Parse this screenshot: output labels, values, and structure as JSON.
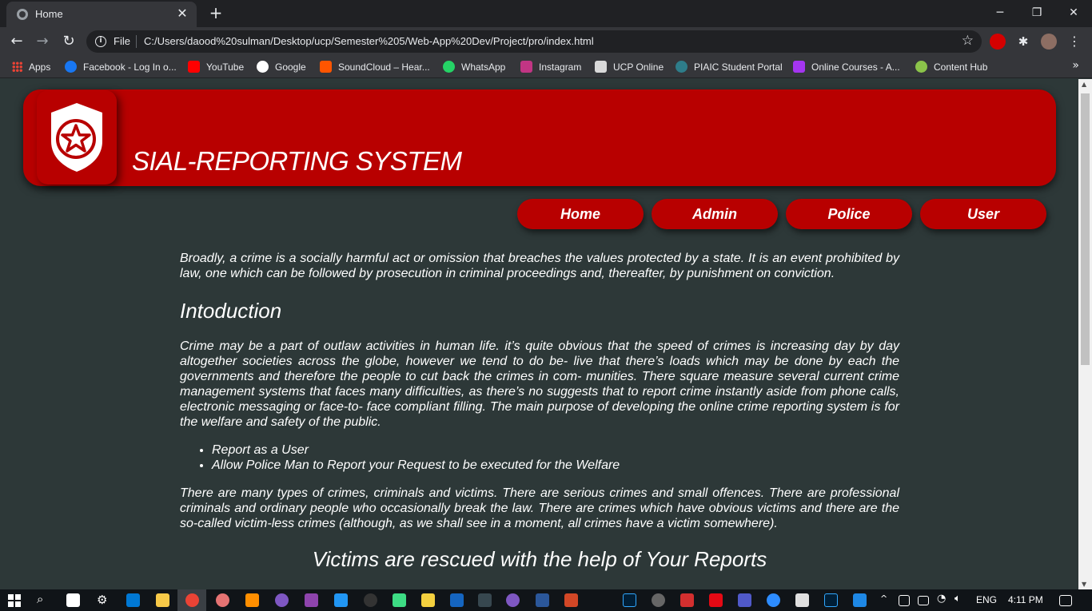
{
  "browser": {
    "tab_title": "Home",
    "tab_close": "✕",
    "new_tab": "+",
    "window_controls": [
      "─",
      "❐",
      "✕"
    ],
    "url_scheme": "File",
    "url": "C:/Users/daood%20sulman/Desktop/ucp/Semester%205/Web-App%20Dev/Project/pro/index.html",
    "bookmarks": [
      {
        "label": "Apps",
        "icon": "apps-grid-icon",
        "color": "#ea4335"
      },
      {
        "label": "Facebook - Log In o...",
        "icon": "facebook-icon",
        "color": "#1877f2"
      },
      {
        "label": "YouTube",
        "icon": "youtube-icon",
        "color": "#ff0000"
      },
      {
        "label": "Google",
        "icon": "google-icon",
        "color": "#ffffff"
      },
      {
        "label": "SoundCloud – Hear...",
        "icon": "soundcloud-icon",
        "color": "#ff5500"
      },
      {
        "label": "WhatsApp",
        "icon": "whatsapp-icon",
        "color": "#25d366"
      },
      {
        "label": "Instagram",
        "icon": "instagram-icon",
        "color": "#c13584"
      },
      {
        "label": "UCP Online",
        "icon": "ucp-icon",
        "color": "#d9d9d9"
      },
      {
        "label": "PIAIC Student Portal",
        "icon": "piaic-icon",
        "color": "#2e7d8a"
      },
      {
        "label": "Online Courses - A...",
        "icon": "udemy-icon",
        "color": "#a435f0"
      },
      {
        "label": "Content Hub",
        "icon": "content-hub-icon",
        "color": "#8bc34a"
      }
    ]
  },
  "site": {
    "title": "SIAL-REPORTING SYSTEM",
    "brand_color": "#b80000",
    "nav": [
      "Home",
      "Admin",
      "Police",
      "User"
    ]
  },
  "content": {
    "intro": "Broadly, a crime is a socially harmful act or omission that breaches the values protected by a state. It is an event prohibited by law, one which can be followed by prosecution in criminal proceedings and, thereafter, by punishment on conviction.",
    "heading": "Intoduction",
    "paragraph1": "Crime may be a part of outlaw activities in human life. it’s quite obvious that the speed of crimes is increasing day by day altogether societies across the globe, however we tend to do be- live that there’s loads which may be done by each the governments and therefore the people to cut back the crimes in com- munities. There square measure several current crime management systems that faces many difficulties, as there’s no suggests that to report crime instantly aside from phone calls, electronic messaging or face-to- face compliant filling. The main purpose of developing the online crime reporting system is for the welfare and safety of the public.",
    "bullets": [
      "Report as a User",
      "Allow Police Man to Report your Request to be executed for the Welfare"
    ],
    "paragraph2": "There are many types of crimes, criminals and victims. There are serious crimes and small offences. There are professional criminals and ordinary people who occasionally break the law. There are crimes which have obvious victims and there are the so-called victim-less crimes (although, as we shall see in a moment, all crimes have a victim somewhere).",
    "subheading": "Victims are rescued with the help of Your Reports"
  },
  "taskbar": {
    "language": "ENG",
    "time": "4:11 PM"
  }
}
